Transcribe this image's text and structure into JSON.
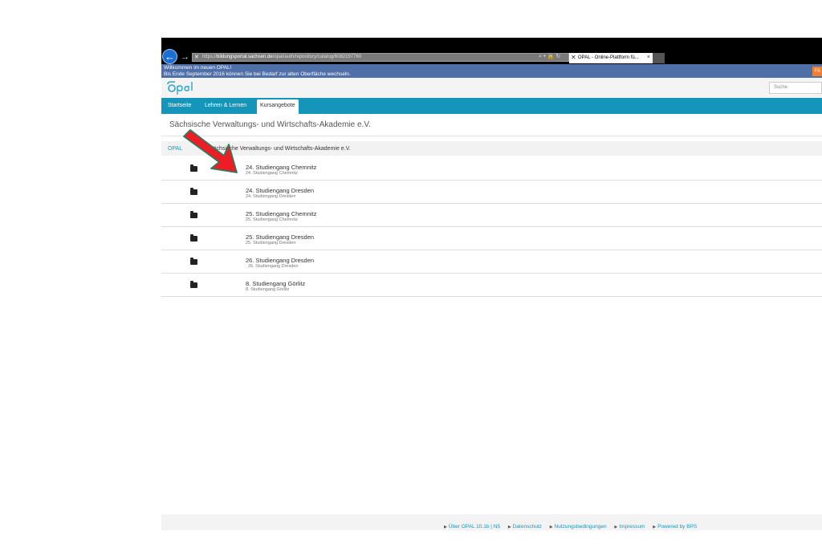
{
  "browser": {
    "url_prefix": "https://",
    "url_host": "bildungsportal.sachsen.de",
    "url_path": "/opal/auth/repository/catalog/6082197760",
    "addr_icons": "⌕ ▾ 🔒 ↻",
    "tab_title": "OPAL - Online-Plattform fü...",
    "tab_close": "×"
  },
  "notice": {
    "line1": "Willkommen im neuen OPAL!",
    "line2": "Bis Ende September 2016 können Sie bei Bedarf zur alten Oberfläche wechseln.",
    "button_label": "FA"
  },
  "header": {
    "logo_text": "Opal",
    "search_placeholder": "Suche"
  },
  "nav": {
    "items": [
      {
        "label": "Startseite"
      },
      {
        "label": "Lehren & Lernen"
      },
      {
        "label": "Kursangebote"
      }
    ]
  },
  "content": {
    "page_title": "Sächsische Verwaltungs- und Wirtschafts-Akademie e.V.",
    "breadcrumb_root": "OPAL",
    "breadcrumb_current": "Sächsische Verwaltungs- und Wirtschafts-Akademie e.V.",
    "rows": [
      {
        "title": "24. Studiengang Chemnitz",
        "subtitle": "24. Studiengang Chemnitz"
      },
      {
        "title": "24. Studiengang Dresden",
        "subtitle": "24. Studiengang Dresden"
      },
      {
        "title": "25. Studiengang Chemnitz",
        "subtitle": "25. Studiengang Chemnitz"
      },
      {
        "title": "25. Studiengang Dresden",
        "subtitle": "25. Studiengang Dresden"
      },
      {
        "title": "26. Studiengang Dresden",
        "subtitle": "26. Studiengang Dresden"
      },
      {
        "title": "8. Studiengang Görlitz",
        "subtitle": "8. Studiengang Görlitz"
      }
    ]
  },
  "footer": {
    "links": [
      {
        "label": "Über OPAL 10.1b | N5"
      },
      {
        "label": "Datenschutz"
      },
      {
        "label": "Nutzungsbedingungen"
      },
      {
        "label": "Impressum"
      },
      {
        "label": "Powered by BPS"
      }
    ]
  },
  "colors": {
    "nav": "#1695ba",
    "notice": "#4e6fa8",
    "arrow_fill": "#ee1c25",
    "arrow_stroke": "#2e7a5a"
  }
}
